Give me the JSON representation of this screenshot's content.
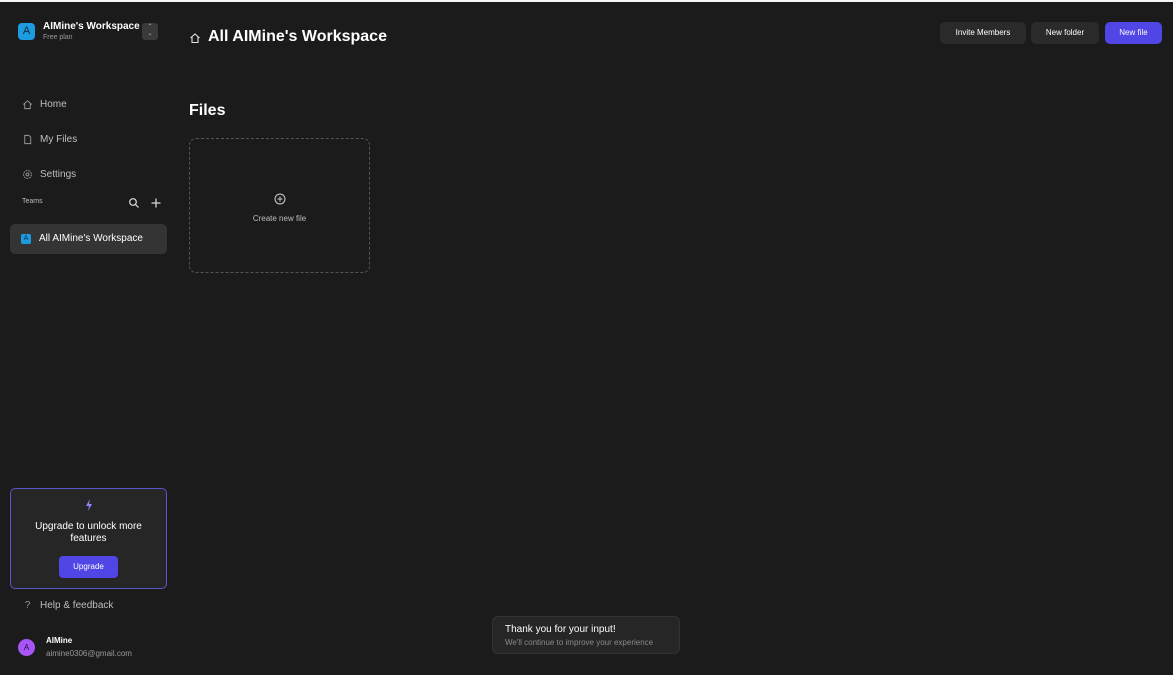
{
  "workspace": {
    "logo_letter": "A",
    "name": "AIMine's Workspace",
    "plan": "Free plan"
  },
  "nav": {
    "home": "Home",
    "my_files": "My Files",
    "settings": "Settings"
  },
  "teams": {
    "label": "Teams",
    "items": [
      {
        "logo_letter": "A",
        "name": "All AIMine's Workspace"
      }
    ]
  },
  "upgrade": {
    "text": "Upgrade to unlock more features",
    "button": "Upgrade"
  },
  "help": {
    "label": "Help & feedback"
  },
  "user": {
    "avatar_letter": "A",
    "name": "AIMine",
    "email": "aimine0306@gmail.com"
  },
  "header": {
    "title": "All AIMine's Workspace",
    "buttons": {
      "invite": "Invite Members",
      "new_folder": "New folder",
      "new_file": "New file"
    }
  },
  "main": {
    "section_title": "Files",
    "create_new_file": "Create new file"
  },
  "toast": {
    "title": "Thank you for your input!",
    "subtitle": "We'll continue to improve your experience"
  },
  "colors": {
    "background": "#1b1b1b",
    "accent": "#5046e5",
    "logo_blue": "#1e9be0",
    "avatar_purple": "#a855f7"
  },
  "icons": {
    "home": "home-icon",
    "file": "file-icon",
    "settings": "gear-icon",
    "search": "search-icon",
    "plus": "plus-icon",
    "bolt": "lightning-icon",
    "help": "question-icon",
    "add_circle": "plus-circle-icon"
  }
}
